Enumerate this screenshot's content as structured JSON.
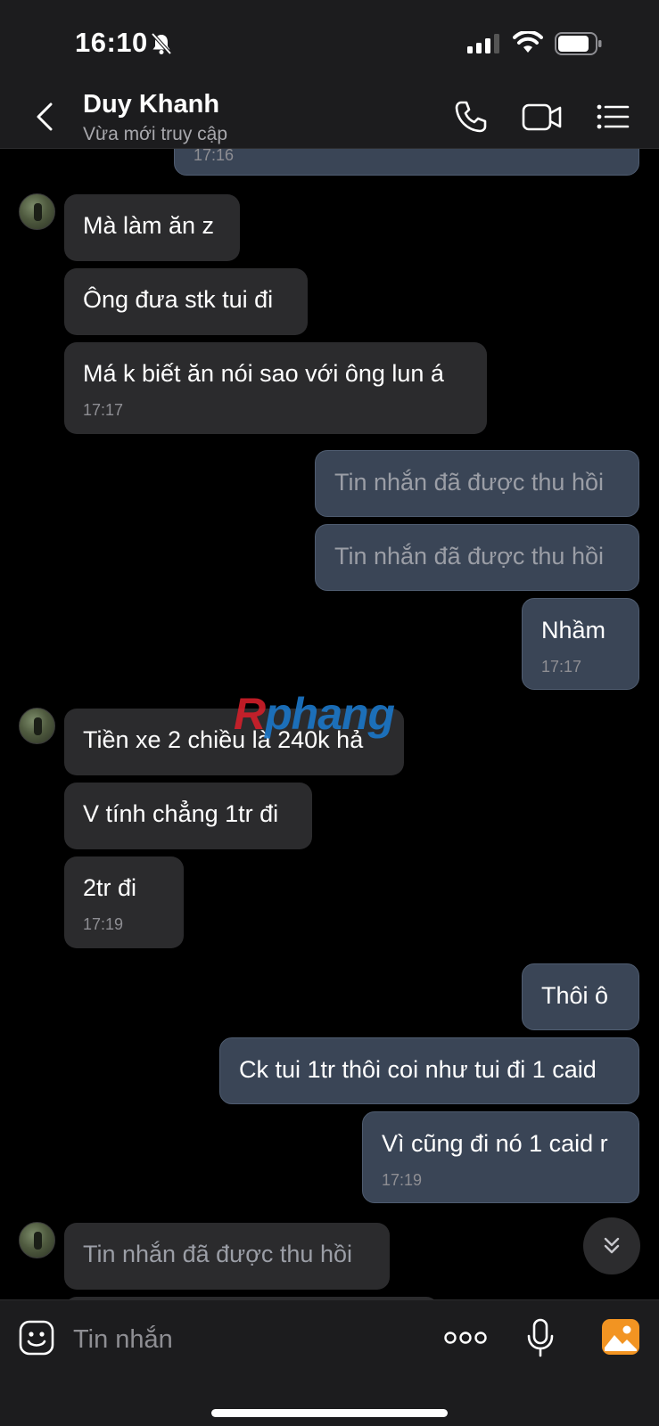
{
  "status_bar": {
    "time": "16:10"
  },
  "header": {
    "name": "Duy Khanh",
    "status": "Vừa mới truy cập"
  },
  "messages": {
    "m0": {
      "time": "17:16"
    },
    "m1": {
      "text": "Mà làm ăn z"
    },
    "m2": {
      "text": "Ông đưa stk tui đi"
    },
    "m3": {
      "text": "Má k biết ăn nói sao với ông lun á",
      "time": "17:17"
    },
    "m4": {
      "text": "Tin nhắn đã được thu hồi"
    },
    "m5": {
      "text": "Tin nhắn đã được thu hồi"
    },
    "m6": {
      "text": "Nhầm",
      "time": "17:17"
    },
    "m7": {
      "text": "Tiền xe 2 chiều là 240k hả"
    },
    "m8": {
      "text": "V tính chẳng 1tr đi"
    },
    "m9": {
      "text": "2tr đi",
      "time": "17:19"
    },
    "m10": {
      "text": "Thôi ô"
    },
    "m11": {
      "text": "Ck tui 1tr thôi coi như tui đi 1 caid"
    },
    "m12": {
      "text": "Vì cũng đi nó 1 caid r",
      "time": "17:19"
    },
    "m13": {
      "text": "Tin nhắn đã được thu hồi"
    }
  },
  "watermark": {
    "first": "R",
    "rest": "phang"
  },
  "input": {
    "placeholder": "Tin nhắn"
  },
  "icons": [
    "back-icon",
    "phone-icon",
    "video-icon",
    "menu-icon",
    "bell-off-icon",
    "sticker-icon",
    "more-icon",
    "microphone-icon",
    "image-icon",
    "double-chevron-down-icon"
  ]
}
